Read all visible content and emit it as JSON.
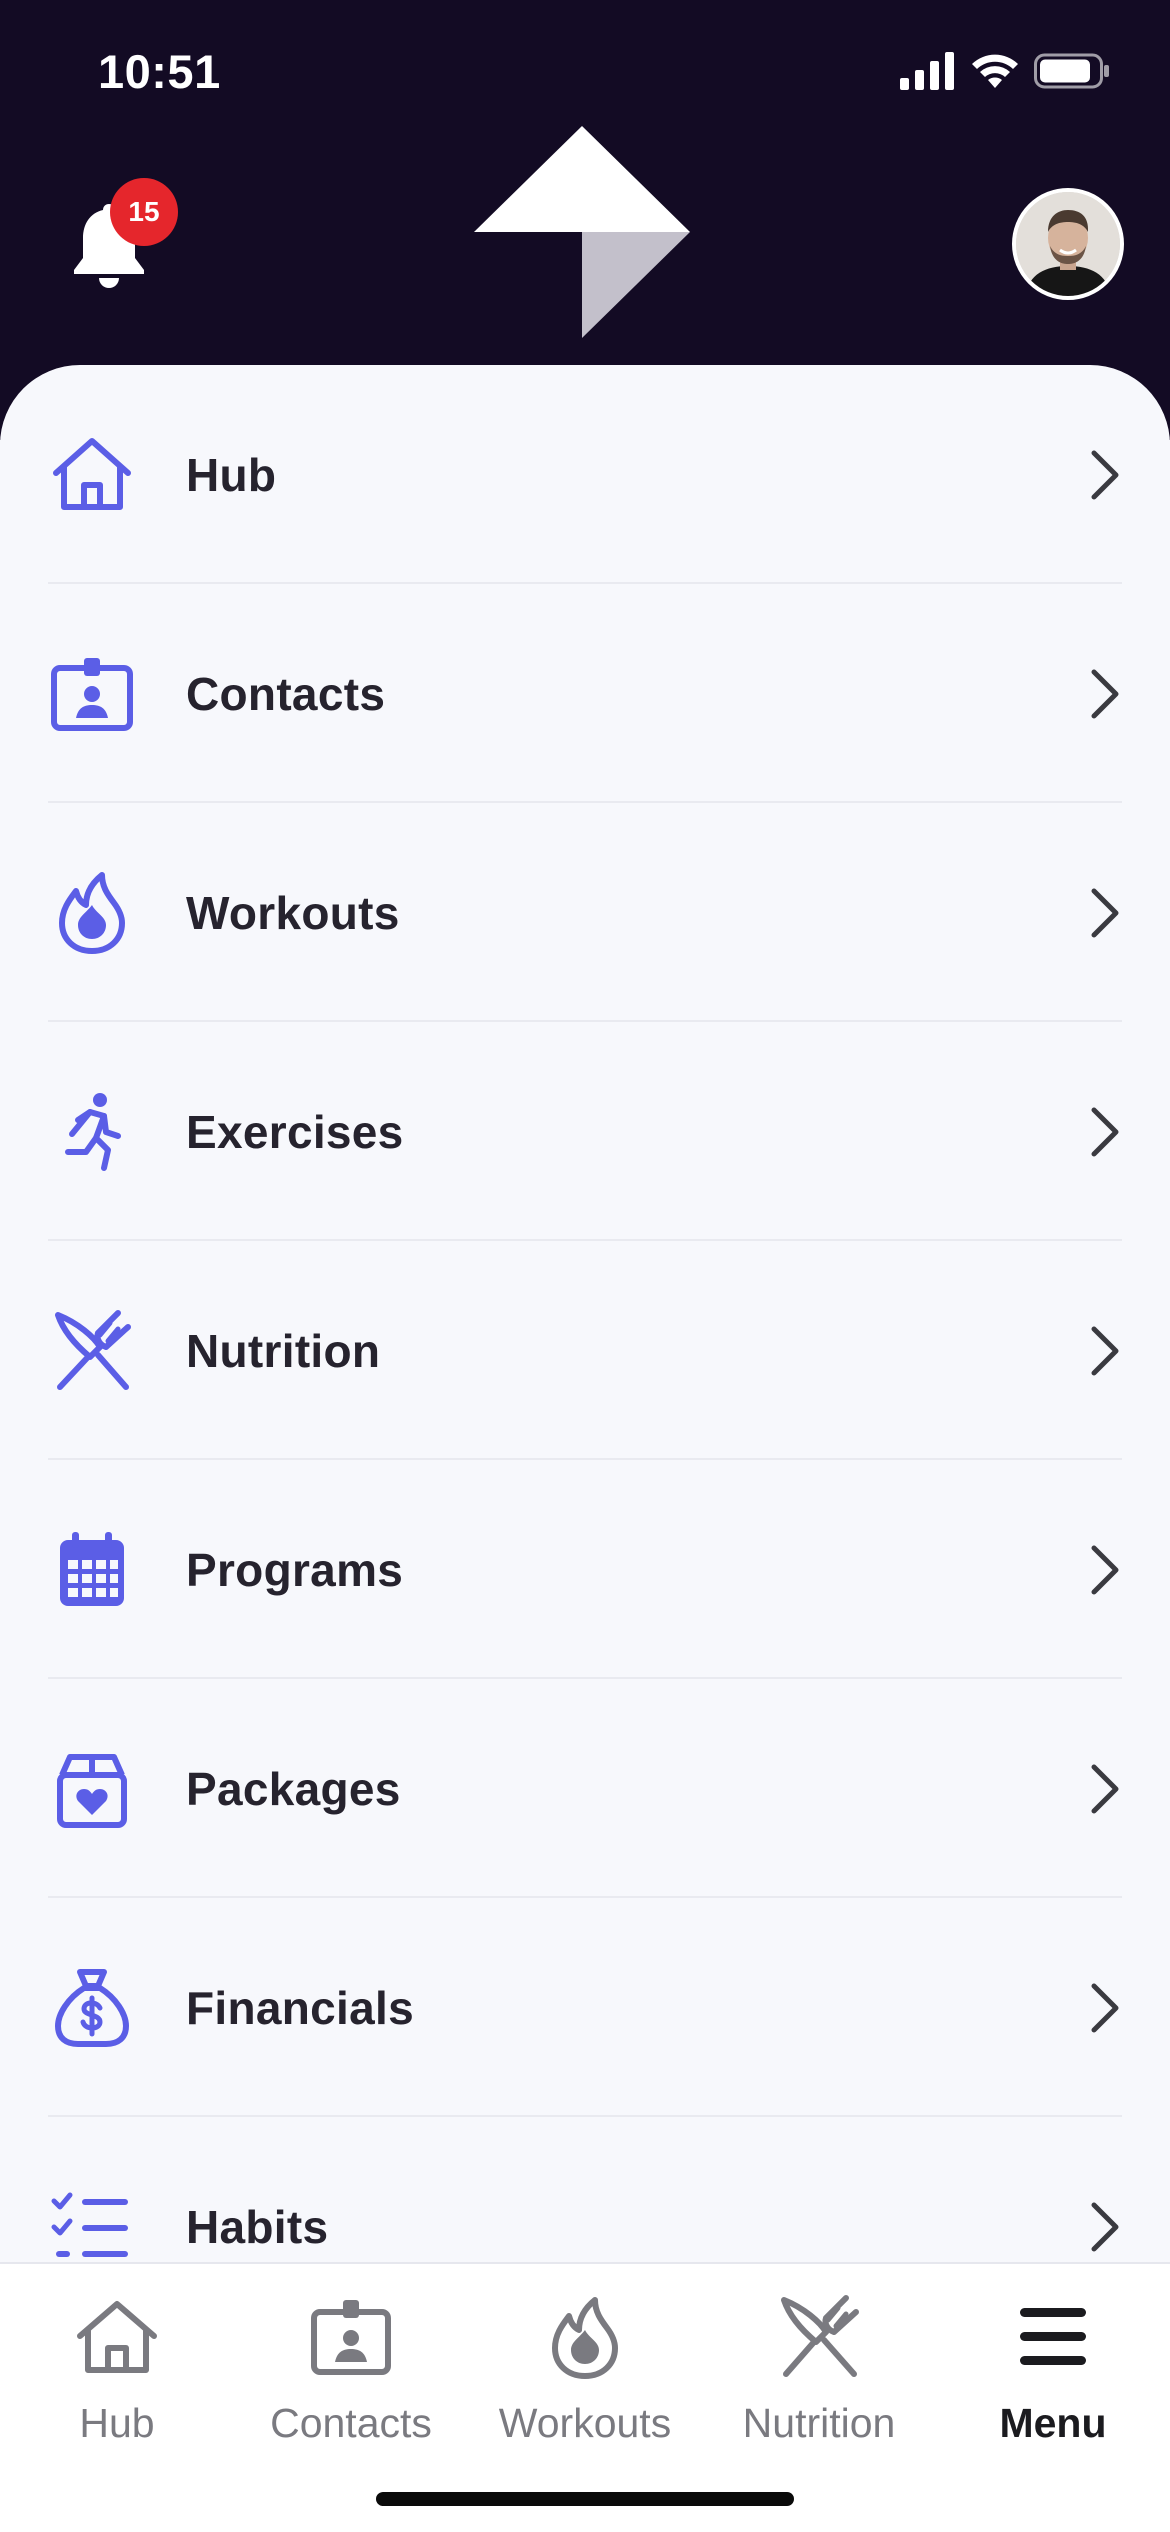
{
  "status_bar": {
    "time": "10:51"
  },
  "header": {
    "notification_count": "15"
  },
  "colors": {
    "header_bg": "#130b24",
    "accent": "#5b5ee6",
    "badge": "#e5262c",
    "tab_inactive": "#7a7a80",
    "tab_active": "#1b1b1f"
  },
  "menu": {
    "items": [
      {
        "label": "Hub",
        "icon": "home-icon"
      },
      {
        "label": "Contacts",
        "icon": "contact-card-icon"
      },
      {
        "label": "Workouts",
        "icon": "flame-icon"
      },
      {
        "label": "Exercises",
        "icon": "running-person-icon"
      },
      {
        "label": "Nutrition",
        "icon": "fork-knife-icon"
      },
      {
        "label": "Programs",
        "icon": "calendar-icon"
      },
      {
        "label": "Packages",
        "icon": "package-heart-icon"
      },
      {
        "label": "Financials",
        "icon": "money-bag-icon"
      },
      {
        "label": "Habits",
        "icon": "checklist-icon"
      }
    ]
  },
  "tabbar": {
    "tabs": [
      {
        "label": "Hub",
        "icon": "home-icon",
        "active": false
      },
      {
        "label": "Contacts",
        "icon": "contact-card-icon",
        "active": false
      },
      {
        "label": "Workouts",
        "icon": "flame-icon",
        "active": false
      },
      {
        "label": "Nutrition",
        "icon": "fork-knife-icon",
        "active": false
      },
      {
        "label": "Menu",
        "icon": "hamburger-menu-icon",
        "active": true
      }
    ]
  }
}
